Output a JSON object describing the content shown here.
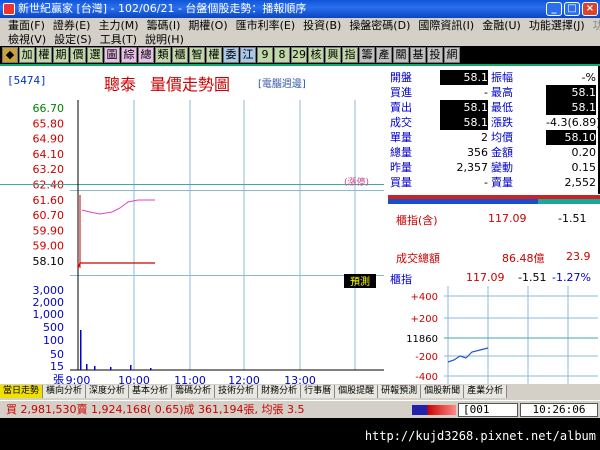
{
  "window": {
    "title": "新世紀贏家 [台灣] - 102/06/21 - 台盤個股走勢：播報順序"
  },
  "menus": [
    {
      "label": "畫面(F)"
    },
    {
      "label": "證券(E)"
    },
    {
      "label": "主力(M)"
    },
    {
      "label": "籌碼(I)"
    },
    {
      "label": "期權(O)"
    },
    {
      "label": "匯市利率(E)"
    },
    {
      "label": "投資(B)"
    },
    {
      "label": "操盤密碼(D)"
    },
    {
      "label": "國際資訊(I)"
    },
    {
      "label": "金融(U)"
    },
    {
      "label": "功能選擇(J)"
    },
    {
      "label": "功能操作(A)"
    },
    {
      "label": "檢視(V)"
    },
    {
      "label": "設定(S)"
    },
    {
      "label": "工具(T)"
    },
    {
      "label": "說明(H)"
    }
  ],
  "toolbar": [
    {
      "label": "◆",
      "color": "#c8a040"
    },
    {
      "label": "加",
      "color": "#c0d8a8"
    },
    {
      "label": "權",
      "color": "#c0d8a8"
    },
    {
      "label": "期",
      "color": "#c0d8a8"
    },
    {
      "label": "價",
      "color": "#c0d8a8"
    },
    {
      "label": "選",
      "color": "#c0d8a8"
    },
    {
      "label": "圖",
      "color": "#e8c0e8"
    },
    {
      "label": "綜",
      "color": "#e8c0e8"
    },
    {
      "label": "總",
      "color": "#e8c0e8"
    },
    {
      "label": "類",
      "color": "#c0d8a8"
    },
    {
      "label": "櫃",
      "color": "#c0d8a8"
    },
    {
      "label": "智",
      "color": "#c0d8a8"
    },
    {
      "label": "權",
      "color": "#c0d8a8"
    },
    {
      "label": "委",
      "color": "#a8c8e8"
    },
    {
      "label": "江",
      "color": "#a8c8e8"
    },
    {
      "label": "9",
      "color": "#c0d8a8"
    },
    {
      "label": "8",
      "color": "#c0d8a8"
    },
    {
      "label": "29",
      "color": "#c0d8a8"
    },
    {
      "label": "核",
      "color": "#c0d8a8"
    },
    {
      "label": "興",
      "color": "#c0d8a8"
    },
    {
      "label": "指",
      "color": "#c0d8a8"
    },
    {
      "label": "籌",
      "color": "#c0c0c0"
    },
    {
      "label": "產",
      "color": "#c0c0c0"
    },
    {
      "label": "關",
      "color": "#c0c0c0"
    },
    {
      "label": "基",
      "color": "#c0c0c0"
    },
    {
      "label": "投",
      "color": "#c0c0c0"
    },
    {
      "label": "網",
      "color": "#c0c0c0"
    }
  ],
  "stock": {
    "code": "[5474]",
    "name": "聰泰",
    "view": "量價走勢圖",
    "tag": "[電腦週邊]"
  },
  "quote": {
    "rows": [
      {
        "l1": "開盤",
        "v1": "58.1",
        "l2": "振幅",
        "v2": "-%",
        "b1": true,
        "b2": false
      },
      {
        "l1": "買進",
        "v1": "-",
        "l2": "最高",
        "v2": "58.1",
        "b1": false,
        "b2": true
      },
      {
        "l1": "賣出",
        "v1": "58.1",
        "l2": "最低",
        "v2": "58.1",
        "b1": true,
        "b2": true
      },
      {
        "l1": "成交",
        "v1": "58.1",
        "l2": "漲跌",
        "v2": "-4.3(6.89)",
        "b1": true,
        "b2": false
      },
      {
        "l1": "單量",
        "v1": "2",
        "l2": "均價",
        "v2": "58.10",
        "b1": false,
        "b2": true
      },
      {
        "l1": "總量",
        "v1": "356",
        "l2": "金額",
        "v2": "0.20",
        "b1": false,
        "b2": false
      },
      {
        "l1": "昨量",
        "v1": "2,357",
        "l2": "變動",
        "v2": "0.15",
        "b1": false,
        "b2": false
      },
      {
        "l1": "買量",
        "v1": "-",
        "l2": "賣量",
        "v2": "2,552",
        "b1": false,
        "b2": false
      }
    ]
  },
  "index_panel": {
    "label": "櫃指(含)",
    "value": "117.09",
    "change": "-1.51",
    "turnover_label": "成交總額",
    "turnover_value": "86.48億",
    "turnover_change": "23.9"
  },
  "index_mini": {
    "label": "櫃指",
    "value": "117.09",
    "change": "-1.51",
    "pct": "-1.27%",
    "yticks": [
      "+400",
      "+200",
      "11860",
      "-200",
      "-400"
    ]
  },
  "chart": {
    "prices": [
      "66.70",
      "65.80",
      "64.90",
      "64.10",
      "63.20",
      "62.40",
      "61.60",
      "60.70",
      "59.90",
      "59.00",
      "58.10"
    ],
    "volumes": [
      "3,000",
      "2,000",
      "1,000",
      "500",
      "100",
      "50",
      "15",
      "張"
    ],
    "times": [
      "9:00",
      "10:00",
      "11:00",
      "12:00",
      "13:00"
    ],
    "limit_label": "(漲停)",
    "predict_label": "預測",
    "price_colors": [
      "#008000",
      "#cc0000",
      "#cc0000",
      "#cc0000",
      "#cc0000",
      "#cc0000",
      "#cc0000",
      "#cc0000",
      "#cc0000",
      "#cc0000",
      "#000000"
    ]
  },
  "tabs": [
    {
      "label": "當日走勢",
      "active": true
    },
    {
      "label": "橫向分析",
      "active": false
    },
    {
      "label": "深度分析",
      "active": false
    },
    {
      "label": "基本分析",
      "active": false
    },
    {
      "label": "籌碼分析",
      "active": false
    },
    {
      "label": "技術分析",
      "active": false
    },
    {
      "label": "財務分析",
      "active": false
    },
    {
      "label": "行事曆",
      "active": false
    },
    {
      "label": "個股提醒",
      "active": false
    },
    {
      "label": "研報預測",
      "active": false
    },
    {
      "label": "個股新聞",
      "active": false
    },
    {
      "label": "產業分析",
      "active": false
    }
  ],
  "status": {
    "text": "買 2,981,530賣 1,924,168( 0.65)成 361,194張, 均張 3.5",
    "box": "[001",
    "clock": "10:26:06"
  },
  "footer": {
    "url": "http://kujd3268.pixnet.net/album"
  }
}
